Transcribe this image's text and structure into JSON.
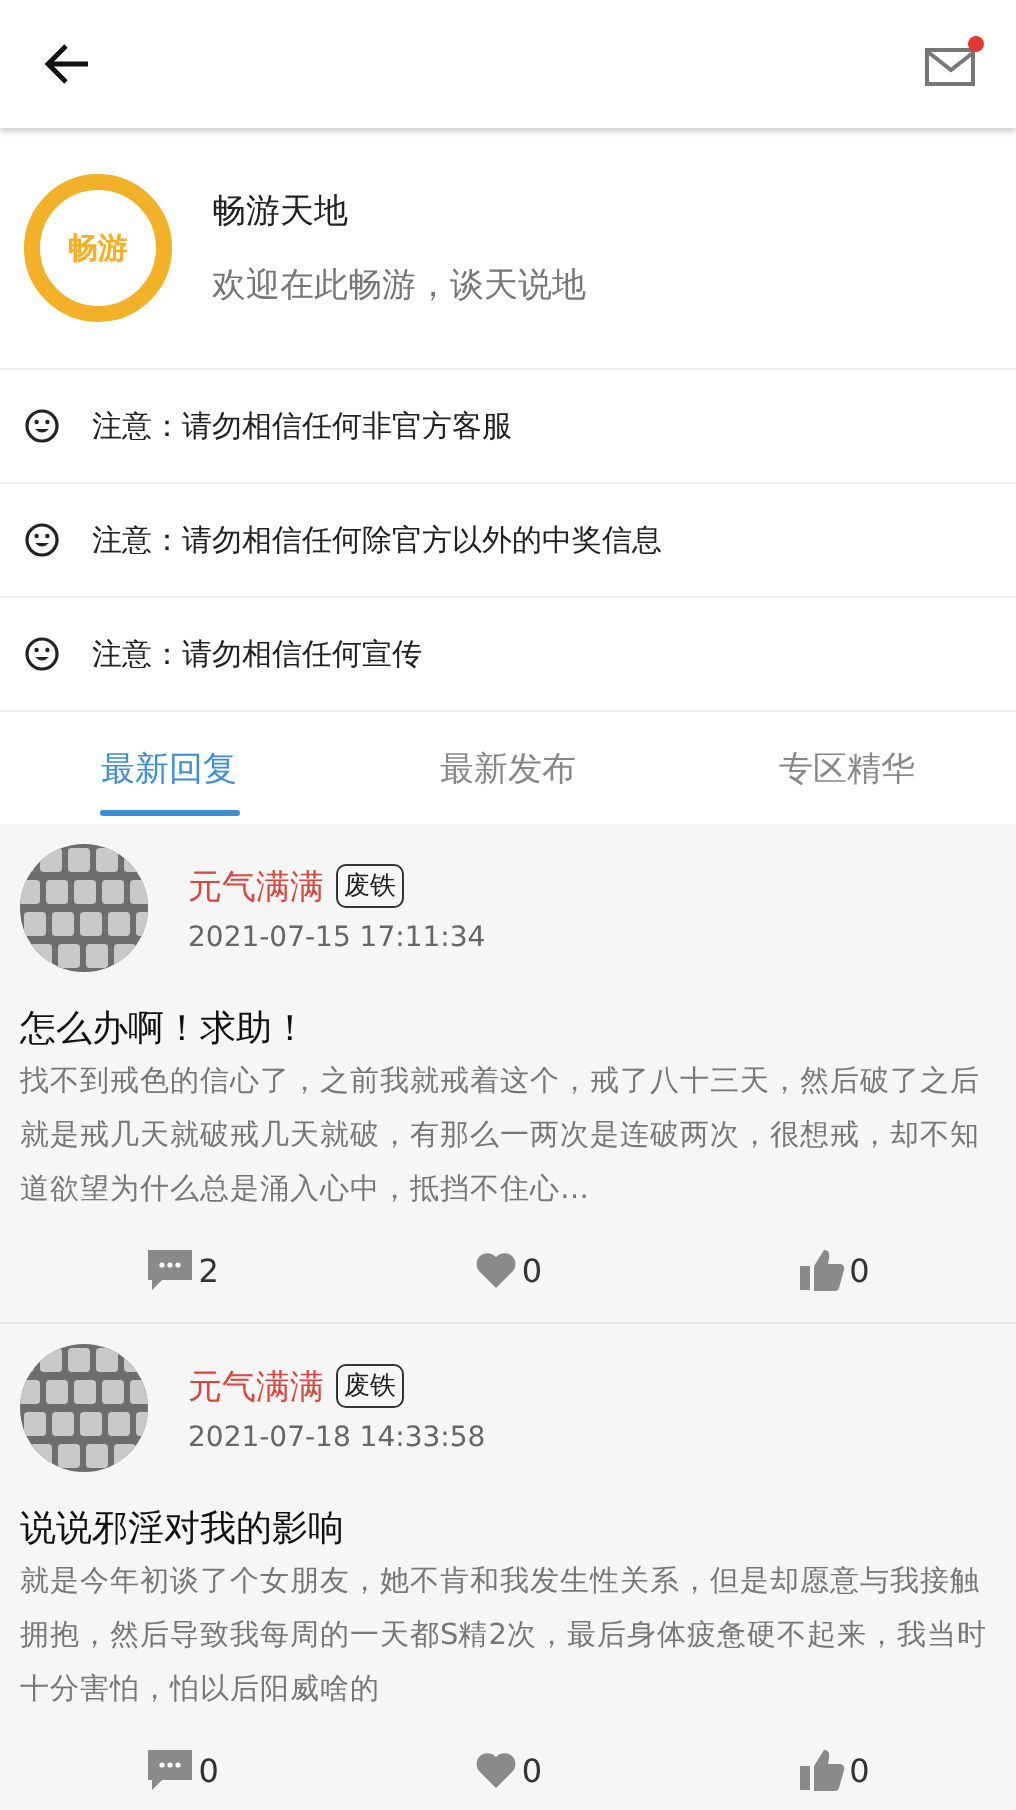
{
  "header": {
    "has_unread_mail": true
  },
  "forum": {
    "logo_text": "畅游",
    "name": "畅游天地",
    "slogan": "欢迎在此畅游，谈天说地"
  },
  "notices": [
    {
      "text": "注意：请勿相信任何非官方客服"
    },
    {
      "text": "注意：请勿相信任何除官方以外的中奖信息"
    },
    {
      "text": "注意：请勿相信任何宣传"
    }
  ],
  "tabs": [
    {
      "label": "最新回复",
      "selected": true
    },
    {
      "label": "最新发布",
      "selected": false
    },
    {
      "label": "专区精华",
      "selected": false
    }
  ],
  "posts": [
    {
      "author": "元气满满",
      "badge": "废铁",
      "time": "2021-07-15 17:11:34",
      "title": "怎么办啊！求助！",
      "body": "找不到戒色的信心了，之前我就戒着这个，戒了八十三天，然后破了之后就是戒几天就破戒几天就破，有那么一两次是连破两次，很想戒，却不知道欲望为什么总是涌入心中，抵挡不住心…",
      "comments": "2",
      "favorites": "0",
      "likes": "0"
    },
    {
      "author": "元气满满",
      "badge": "废铁",
      "time": "2021-07-18 14:33:58",
      "title": "说说邪淫对我的影响",
      "body": "就是今年初谈了个女朋友，她不肯和我发生性关系，但是却愿意与我接触拥抱，然后导致我每周的一天都S精2次，最后身体疲惫硬不起来，我当时十分害怕，怕以后阳威啥的",
      "comments": "0",
      "favorites": "0",
      "likes": "0"
    }
  ]
}
